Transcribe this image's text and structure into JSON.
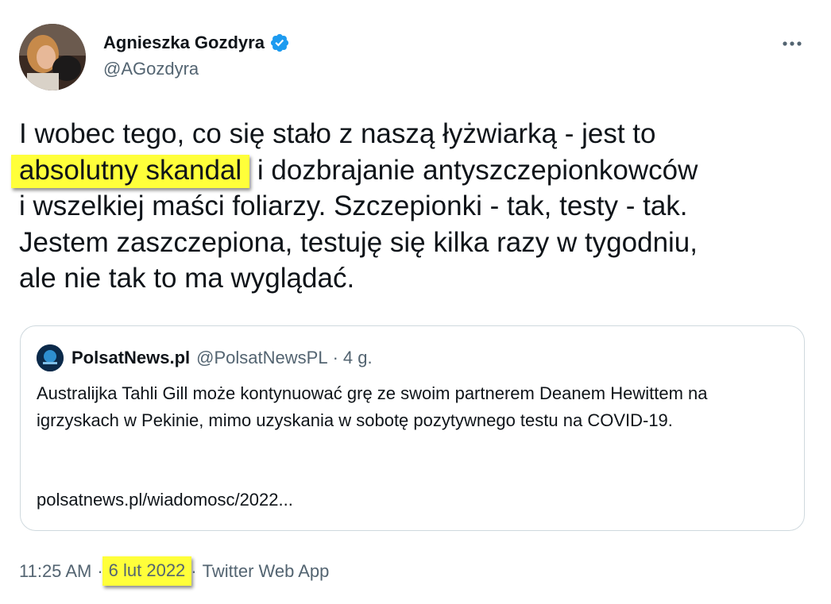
{
  "author": {
    "display_name": "Agnieszka Gozdyra",
    "handle": "@AGozdyra",
    "verified": true
  },
  "tweet": {
    "line1": "I wobec tego, co się stało z naszą łyżwiarką - jest to",
    "highlighted": "absolutny skandal",
    "line2_rest": " i dozbrajanie antyszczepionkowców",
    "line3": "i wszelkiej maści foliarzy. Szczepionki - tak, testy - tak.",
    "line4": "Jestem zaszczepiona, testuję się kilka razy w tygodniu,",
    "line5": "ale nie tak to ma wyglądać."
  },
  "quote": {
    "name": "PolsatNews.pl",
    "handle": "@PolsatNewsPL",
    "separator": "·",
    "time": "4 g.",
    "text": "Australijka Tahli Gill może kontynuować grę ze swoim partnerem Deanem Hewittem na igrzyskach w Pekinie, mimo uzyskania w sobotę pozytywnego testu na COVID-19.",
    "link": "polsatnews.pl/wiadomosc/2022..."
  },
  "meta": {
    "time": "11:25 AM",
    "separator": "·",
    "date": "6 lut 2022",
    "source": "Twitter Web App"
  },
  "colors": {
    "highlight": "#ffff3a",
    "verified": "#1d9bf0",
    "secondary_text": "#536471",
    "border": "#cfd9de"
  },
  "icons": {
    "verified": "verified-badge-icon",
    "more": "more-dots-icon"
  }
}
